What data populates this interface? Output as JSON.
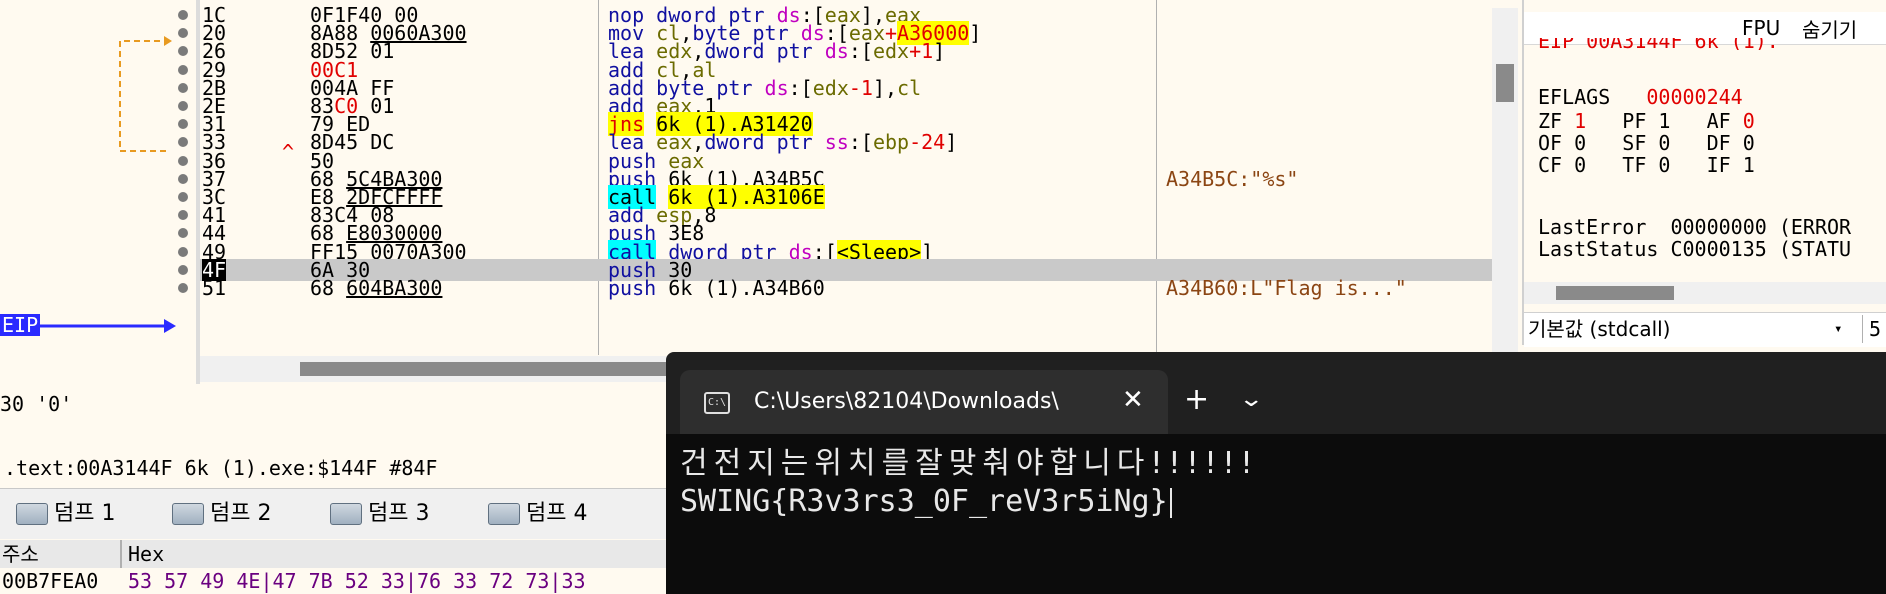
{
  "disasm": {
    "rows": [
      {
        "addr": "1C",
        "bytes": "0F1F40 00",
        "instr": "nop dword ptr ds:[eax],eax",
        "comment": ""
      },
      {
        "addr": "20",
        "bytes": "8A88 0060A300",
        "instr": "mov cl,byte ptr ds:[eax+A36000]",
        "comment": ""
      },
      {
        "addr": "26",
        "bytes": "8D52 01",
        "instr": "lea edx,dword ptr ds:[edx+1]",
        "comment": ""
      },
      {
        "addr": "29",
        "bytes": "00C1",
        "instr": "add cl,al",
        "comment": ""
      },
      {
        "addr": "2B",
        "bytes": "004A FF",
        "instr": "add byte ptr ds:[edx-1],cl",
        "comment": ""
      },
      {
        "addr": "2E",
        "bytes": "83C0 01",
        "instr": "add eax,1",
        "comment": ""
      },
      {
        "addr": "31",
        "bytes": "79 ED",
        "instr": "jns 6k (1).A31420",
        "comment": ""
      },
      {
        "addr": "33",
        "bytes": "8D45 DC",
        "instr": "lea eax,dword ptr ss:[ebp-24]",
        "comment": ""
      },
      {
        "addr": "36",
        "bytes": "50",
        "instr": "push eax",
        "comment": ""
      },
      {
        "addr": "37",
        "bytes": "68 5C4BA300",
        "instr": "push 6k (1).A34B5C",
        "comment": "A34B5C:\"%s\""
      },
      {
        "addr": "3C",
        "bytes": "E8 2DFCFFFF",
        "instr": "call 6k (1).A3106E",
        "comment": ""
      },
      {
        "addr": "41",
        "bytes": "83C4 08",
        "instr": "add esp,8",
        "comment": ""
      },
      {
        "addr": "44",
        "bytes": "68 E8030000",
        "instr": "push 3E8",
        "comment": ""
      },
      {
        "addr": "49",
        "bytes": "FF15 0070A300",
        "instr": "call dword ptr ds:[<Sleep>]",
        "comment": ""
      },
      {
        "addr": "4F",
        "bytes": "6A 30",
        "instr": "push 30",
        "comment": ""
      },
      {
        "addr": "51",
        "bytes": "68 604BA300",
        "instr": "push 6k (1).A34B60",
        "comment": "A34B60:L\"Flag is...\""
      }
    ],
    "eip_label": "EIP",
    "jump_marker": "^"
  },
  "info": {
    "value": "30 '0'",
    "location": ".text:00A3144F 6k (1).exe:$144F #84F"
  },
  "dump_tabs": [
    "덤프 1",
    "덤프 2",
    "덤프 3",
    "덤프 4"
  ],
  "hex": {
    "header_addr": "주소",
    "header_hex": "Hex",
    "row_addr": "00B7FEA0",
    "row_bytes": "53 57 49 4E|47 7B 52 33|76 33 72 73|33"
  },
  "registers": {
    "fpu_label": "FPU",
    "hide_label": "숨기기",
    "eip_partial": "EIP    00A3144F      6k (1).",
    "eflags_label": "EFLAGS",
    "eflags_value": "00000244",
    "flags": [
      [
        {
          "n": "ZF",
          "v": "1",
          "changed": true
        },
        {
          "n": "PF",
          "v": "1",
          "changed": false
        },
        {
          "n": "AF",
          "v": "0",
          "changed": true
        }
      ],
      [
        {
          "n": "OF",
          "v": "0",
          "changed": false
        },
        {
          "n": "SF",
          "v": "0",
          "changed": false
        },
        {
          "n": "DF",
          "v": "0",
          "changed": false
        }
      ],
      [
        {
          "n": "CF",
          "v": "0",
          "changed": false
        },
        {
          "n": "TF",
          "v": "0",
          "changed": false
        },
        {
          "n": "IF",
          "v": "1",
          "changed": false
        }
      ]
    ],
    "last_error_label": "LastError",
    "last_error_value": "00000000 (ERROR",
    "last_status_label": "LastStatus",
    "last_status_value": "C0000135 (STATU",
    "callconv": "기본값 (stdcall)",
    "arg_count": "5"
  },
  "terminal": {
    "tab_title": "C:\\Users\\82104\\Downloads\\",
    "line1": "건전지는위치를잘맞춰야합니다!!!!!!",
    "line2": "SWING{R3v3rs3_0F_reV3r5iNg}"
  }
}
